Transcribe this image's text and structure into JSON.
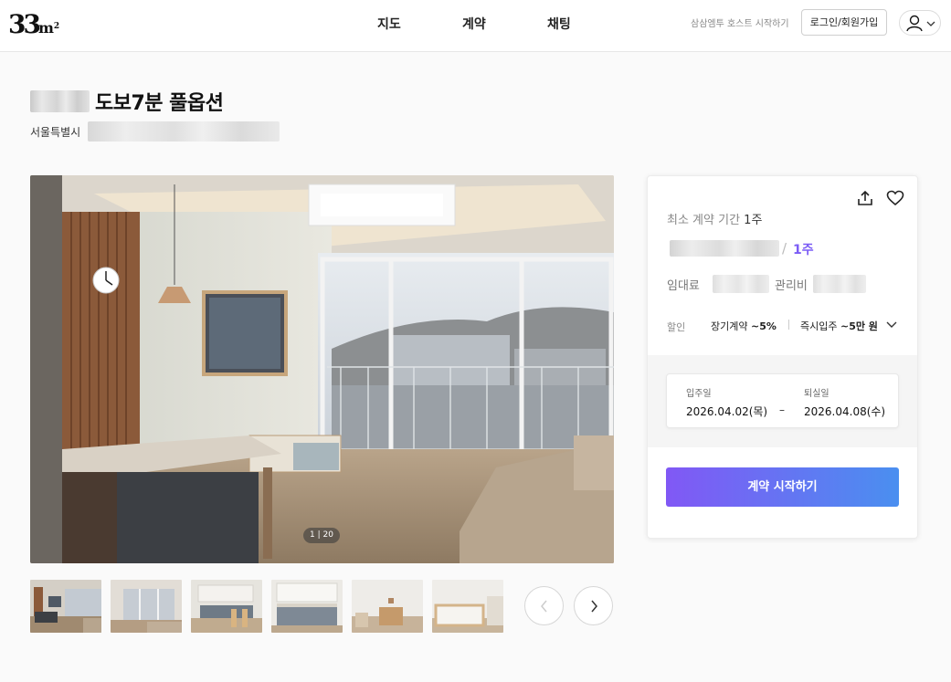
{
  "header": {
    "logo": {
      "number": "33",
      "unit": "m",
      "sup": "2"
    },
    "nav": [
      "지도",
      "계약",
      "채팅"
    ],
    "host_link": "삼삼엠투 호스트 시작하기",
    "login_label": "로그인/회원가입"
  },
  "listing": {
    "title": "도보7분 풀옵션",
    "address_prefix": "서울특별시"
  },
  "gallery": {
    "counter": "1 | 20"
  },
  "booking": {
    "min_period_label": "최소 계약 기간",
    "min_period_value": "1주",
    "price_slash": "/",
    "price_unit": "1주",
    "rent_label": "임대료",
    "fee_label": "관리비",
    "discount_label": "할인",
    "discount_long_label": "장기계약",
    "discount_long_value": "~5%",
    "discount_move_label": "즉시입주",
    "discount_move_value": "~5만 원",
    "checkin_label": "입주일",
    "checkin_value": "2026.04.02(목)",
    "date_dash": "–",
    "checkout_label": "퇴실일",
    "checkout_value": "2026.04.08(수)",
    "start_button": "계약 시작하기"
  },
  "colors": {
    "accent": "#7b5cf5",
    "button_gradient_start": "#8158f5",
    "button_gradient_end": "#4a8ff0"
  }
}
